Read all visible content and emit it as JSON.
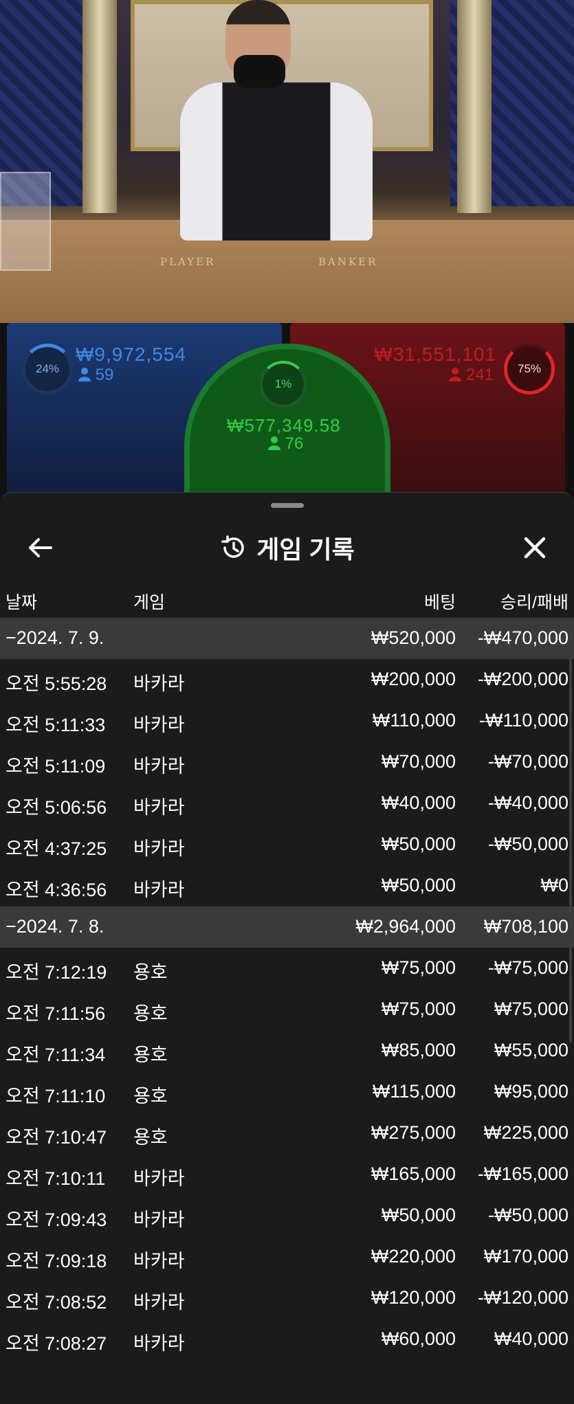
{
  "video": {
    "felt_player": "PLAYER",
    "felt_banker": "BANKER"
  },
  "bets": {
    "player": {
      "percent": "24%",
      "percent_value": 24,
      "amount": "₩9,972,554",
      "people": "59"
    },
    "tie": {
      "percent": "1%",
      "percent_value": 1,
      "amount": "₩577,349.58",
      "people": "76"
    },
    "banker": {
      "percent": "75%",
      "percent_value": 75,
      "amount": "₩31,551,101",
      "people": "241"
    }
  },
  "sheet": {
    "title": "게임 기록",
    "columns": {
      "date": "날짜",
      "game": "게임",
      "bet": "베팅",
      "result": "승리/패배"
    },
    "rows": [
      {
        "type": "day",
        "date": "−2024. 7. 9.",
        "game": "",
        "bet": "₩520,000",
        "result": "-₩470,000"
      },
      {
        "type": "entry",
        "date": "오전 5:55:28",
        "game": "바카라",
        "bet": "₩200,000",
        "result": "-₩200,000"
      },
      {
        "type": "entry",
        "date": "오전 5:11:33",
        "game": "바카라",
        "bet": "₩110,000",
        "result": "-₩110,000"
      },
      {
        "type": "entry",
        "date": "오전 5:11:09",
        "game": "바카라",
        "bet": "₩70,000",
        "result": "-₩70,000"
      },
      {
        "type": "entry",
        "date": "오전 5:06:56",
        "game": "바카라",
        "bet": "₩40,000",
        "result": "-₩40,000"
      },
      {
        "type": "entry",
        "date": "오전 4:37:25",
        "game": "바카라",
        "bet": "₩50,000",
        "result": "-₩50,000"
      },
      {
        "type": "entry",
        "date": "오전 4:36:56",
        "game": "바카라",
        "bet": "₩50,000",
        "result": "₩0"
      },
      {
        "type": "day",
        "date": "−2024. 7. 8.",
        "game": "",
        "bet": "₩2,964,000",
        "result": "₩708,100"
      },
      {
        "type": "entry",
        "date": "오전 7:12:19",
        "game": "용호",
        "bet": "₩75,000",
        "result": "-₩75,000"
      },
      {
        "type": "entry",
        "date": "오전 7:11:56",
        "game": "용호",
        "bet": "₩75,000",
        "result": "₩75,000"
      },
      {
        "type": "entry",
        "date": "오전 7:11:34",
        "game": "용호",
        "bet": "₩85,000",
        "result": "₩55,000"
      },
      {
        "type": "entry",
        "date": "오전 7:11:10",
        "game": "용호",
        "bet": "₩115,000",
        "result": "₩95,000"
      },
      {
        "type": "entry",
        "date": "오전 7:10:47",
        "game": "용호",
        "bet": "₩275,000",
        "result": "₩225,000"
      },
      {
        "type": "entry",
        "date": "오전 7:10:11",
        "game": "바카라",
        "bet": "₩165,000",
        "result": "-₩165,000"
      },
      {
        "type": "entry",
        "date": "오전 7:09:43",
        "game": "바카라",
        "bet": "₩50,000",
        "result": "-₩50,000"
      },
      {
        "type": "entry",
        "date": "오전 7:09:18",
        "game": "바카라",
        "bet": "₩220,000",
        "result": "₩170,000"
      },
      {
        "type": "entry",
        "date": "오전 7:08:52",
        "game": "바카라",
        "bet": "₩120,000",
        "result": "-₩120,000"
      },
      {
        "type": "entry",
        "date": "오전 7:08:27",
        "game": "바카라",
        "bet": "₩60,000",
        "result": "₩40,000"
      }
    ]
  }
}
